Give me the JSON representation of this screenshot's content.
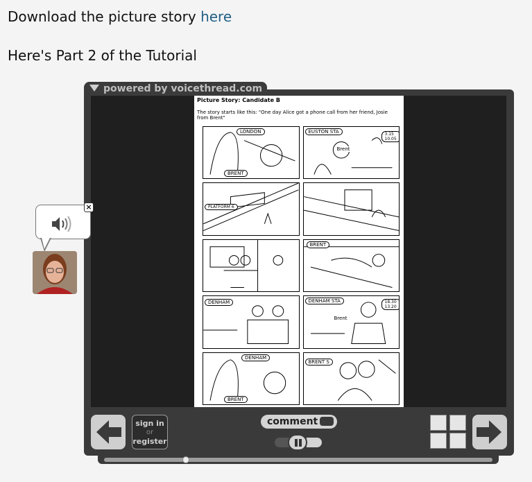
{
  "intro": {
    "download_text": "Download the picture story ",
    "download_link": "here",
    "part_heading": "Here's Part 2 of the Tutorial"
  },
  "player": {
    "brand_tab": "powered by voicethread.com",
    "slide": {
      "title": "Picture Story: Candidate B",
      "intro": "The story starts like this: \"One day Alice got a phone call from her friend, Josie from Brent\"",
      "panel_labels": {
        "p1_london": "LONDON",
        "p1_brent": "BRENT",
        "p2_euston": "EUSTON STA",
        "p2_brent": "Brent",
        "p2_times": "3.15 10.05",
        "p3_platform": "PLATFORM 6",
        "p6_brent": "BRENT",
        "p7_denham": "DENHAM",
        "p8_denham_sta": "DENHAM STA",
        "p8_brent": "Brent",
        "p8_times": "18.30 13.20",
        "p9_denham": "DENHAM",
        "p9_brent": "BRENT",
        "p10_brent": "BRENT S"
      }
    },
    "sign_in": "sign in",
    "or": "or",
    "register": "register",
    "comment_label": "comment",
    "progress": 0.21
  },
  "icons": {
    "prev": "arrow-left-icon",
    "next": "arrow-right-icon",
    "speaker": "speaker-icon",
    "close": "close-icon",
    "play_pause": "pause-icon",
    "rewind": "rewind-icon",
    "fast_forward": "fast-forward-icon"
  },
  "colors": {
    "link": "#1f5f86",
    "player_bg": "#3a3a3a",
    "control_bg": "#cfcfcf"
  }
}
